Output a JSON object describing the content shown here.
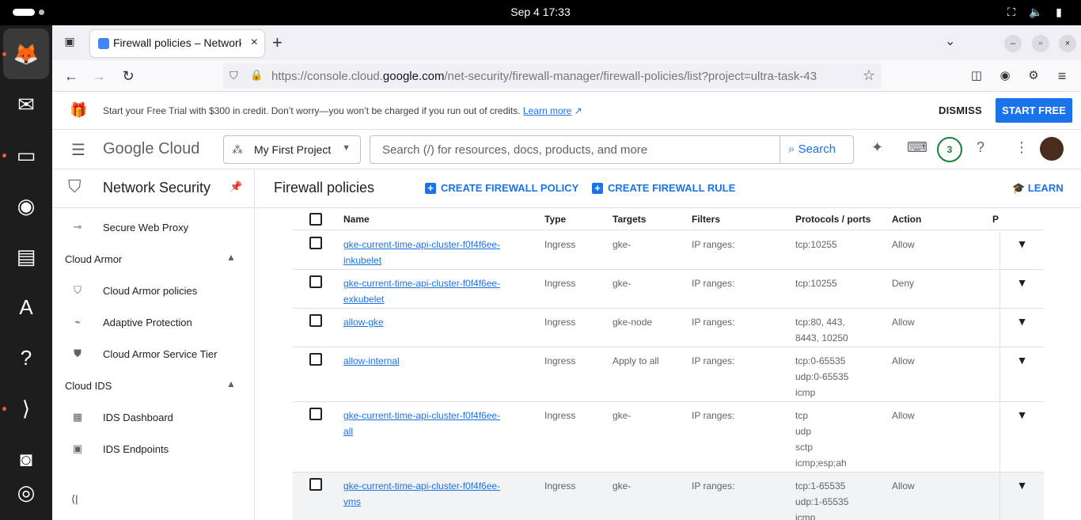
{
  "system": {
    "clock": "Sep 4  17:33"
  },
  "browser": {
    "tab_title": "Firewall policies – Network Security – My First Project",
    "url_prefix": "https://console.cloud.",
    "url_domain": "google.com",
    "url_path": "/net-security/firewall-manager/firewall-policies/list?project=ultra-task-43"
  },
  "trial": {
    "message": "Start your Free Trial with $300 in credit. Don’t worry—you won’t be charged if you run out of credits.",
    "learn_more": "Learn more",
    "dismiss": "DISMISS",
    "start_free": "START FREE"
  },
  "header": {
    "logo_google": "Google",
    "logo_cloud": "Cloud",
    "project": "My First Project",
    "search_placeholder": "Search (/) for resources, docs, products, and more",
    "search_button": "Search",
    "notifications": "3"
  },
  "sidebar": {
    "product": "Network Security",
    "items": [
      {
        "label": "Secure Web Proxy",
        "icon": "proxy-icon"
      },
      {
        "section": "Cloud Armor"
      },
      {
        "label": "Cloud Armor policies",
        "icon": "shield-icon"
      },
      {
        "label": "Adaptive Protection",
        "icon": "chart-icon"
      },
      {
        "label": "Cloud Armor Service Tier",
        "icon": "shield-check-icon"
      },
      {
        "section": "Cloud IDS"
      },
      {
        "label": "IDS Dashboard",
        "icon": "dashboard-icon"
      },
      {
        "label": "IDS Endpoints",
        "icon": "endpoint-icon"
      }
    ]
  },
  "content": {
    "title": "Firewall policies",
    "create_policy": "CREATE FIREWALL POLICY",
    "create_rule": "CREATE FIREWALL RULE",
    "learn": "LEARN",
    "columns": [
      "Name",
      "Type",
      "Targets",
      "Filters",
      "Protocols / ports",
      "Action",
      "P"
    ],
    "rows": [
      {
        "name1": "gke-current-time-api-cluster-f0f4f6ee-",
        "name2": "inkubelet",
        "type": "Ingress",
        "targets": "gke-",
        "filters": "IP ranges:",
        "proto": [
          "tcp:10255"
        ],
        "action": "Allow"
      },
      {
        "name1": "gke-current-time-api-cluster-f0f4f6ee-",
        "name2": "exkubelet",
        "type": "Ingress",
        "targets": "gke-",
        "filters": "IP ranges:",
        "proto": [
          "tcp:10255"
        ],
        "action": "Deny"
      },
      {
        "name1": "allow-gke",
        "name2": "",
        "type": "Ingress",
        "targets": "gke-node",
        "filters": "IP ranges:",
        "proto": [
          "tcp:80, 443,",
          "8443, 10250"
        ],
        "action": "Allow"
      },
      {
        "name1": "allow-internal",
        "name2": "",
        "type": "Ingress",
        "targets": "Apply to all",
        "filters": "IP ranges:",
        "proto": [
          "tcp:0-65535",
          "udp:0-65535",
          "icmp"
        ],
        "action": "Allow"
      },
      {
        "name1": "gke-current-time-api-cluster-f0f4f6ee-",
        "name2": "all",
        "type": "Ingress",
        "targets": "gke-",
        "filters": "IP ranges:",
        "proto": [
          "tcp",
          "udp",
          "sctp",
          "icmp;esp;ah"
        ],
        "action": "Allow"
      },
      {
        "name1": "gke-current-time-api-cluster-f0f4f6ee-",
        "name2": "vms",
        "type": "Ingress",
        "targets": "gke-",
        "filters": "IP ranges:",
        "proto": [
          "tcp:1-65535",
          "udp:1-65535",
          "icmp"
        ],
        "action": "Allow"
      }
    ]
  }
}
